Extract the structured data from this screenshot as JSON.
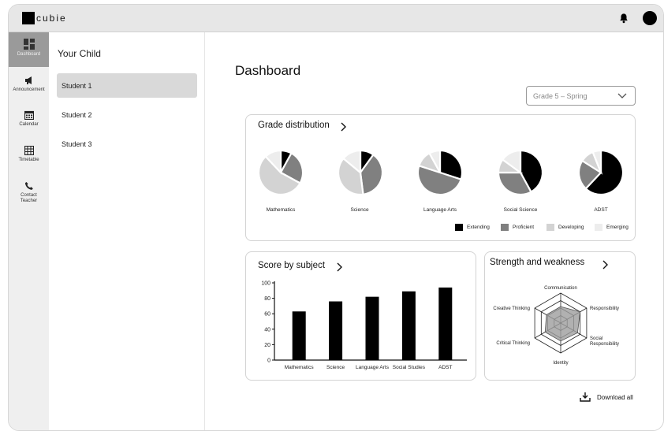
{
  "app": {
    "brand": "cubie"
  },
  "sidebar": {
    "items": [
      {
        "label": "Dashboard",
        "icon": "dashboard-icon"
      },
      {
        "label": "Announcement",
        "icon": "megaphone-icon"
      },
      {
        "label": "Calendar",
        "icon": "calendar-icon"
      },
      {
        "label": "Timetable",
        "icon": "timetable-icon"
      },
      {
        "label": "Contact Teacher",
        "icon": "phone-icon"
      }
    ]
  },
  "children": {
    "title": "Your Child",
    "items": [
      "Student 1",
      "Student 2",
      "Student 3"
    ],
    "selected": "Student 1"
  },
  "main": {
    "title": "Dashboard",
    "grade_select": "Grade 5 – Spring"
  },
  "grade_distribution": {
    "title": "Grade distribution",
    "legend": [
      "Extending",
      "Proficient",
      "Developing",
      "Emerging"
    ],
    "colors": [
      "#000000",
      "#808080",
      "#d3d3d3",
      "#ededed"
    ],
    "subjects": [
      {
        "name": "Mathematics",
        "fractions": [
          0.08,
          0.25,
          0.55,
          0.12
        ]
      },
      {
        "name": "Science",
        "fractions": [
          0.1,
          0.38,
          0.38,
          0.14
        ]
      },
      {
        "name": "Language Arts",
        "fractions": [
          0.3,
          0.5,
          0.12,
          0.08
        ]
      },
      {
        "name": "Social Science",
        "fractions": [
          0.42,
          0.33,
          0.1,
          0.15
        ]
      },
      {
        "name": "ADST",
        "fractions": [
          0.62,
          0.22,
          0.1,
          0.06
        ]
      }
    ]
  },
  "score_by_subject": {
    "title": "Score by subject",
    "chart_data": {
      "type": "bar",
      "categories": [
        "Mathematics",
        "Science",
        "Language Arts",
        "Social Studies",
        "ADST"
      ],
      "values": [
        63,
        76,
        82,
        89,
        94
      ],
      "ylim": [
        0,
        100
      ],
      "yticks": [
        "0",
        "20",
        "40",
        "60",
        "80",
        "100"
      ]
    }
  },
  "strength": {
    "title": "Strength and weakness",
    "axes": [
      "Communication",
      "Responsibility",
      "Social Responsibility",
      "Identity",
      "Critical Thinking",
      "Creative Thinking"
    ],
    "chart_data": {
      "type": "radar",
      "categories": [
        "Communication",
        "Responsibility",
        "Social Responsibility",
        "Identity",
        "Critical Thinking",
        "Creative Thinking"
      ],
      "values": [
        0.55,
        0.75,
        0.65,
        0.6,
        0.6,
        0.55
      ],
      "max": 1
    }
  },
  "footer": {
    "download_label": "Download all"
  }
}
